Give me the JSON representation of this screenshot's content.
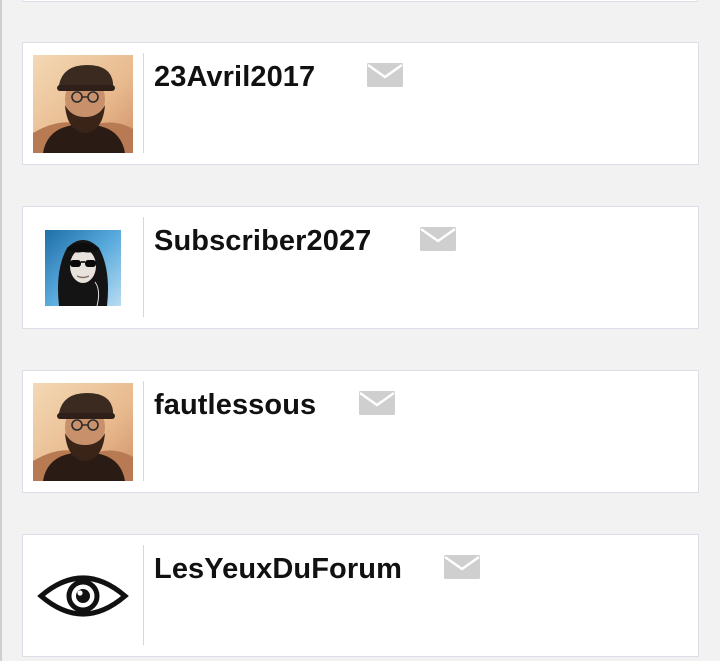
{
  "members": [
    {
      "username": "23Avril2017",
      "avatar": "bearded-man-avatar",
      "icon": "envelope-icon"
    },
    {
      "username": "Subscriber2027",
      "avatar": "hooded-sunglasses-avatar",
      "icon": "envelope-icon"
    },
    {
      "username": "fautlessous",
      "avatar": "bearded-man-avatar",
      "icon": "envelope-icon"
    },
    {
      "username": "LesYeuxDuForum",
      "avatar": "eye-avatar",
      "icon": "envelope-icon"
    }
  ],
  "colors": {
    "background": "#f2f2f2",
    "card": "#ffffff",
    "card_border": "#dcdde6",
    "username": "#111111",
    "envelope": "#cfcfcf"
  }
}
